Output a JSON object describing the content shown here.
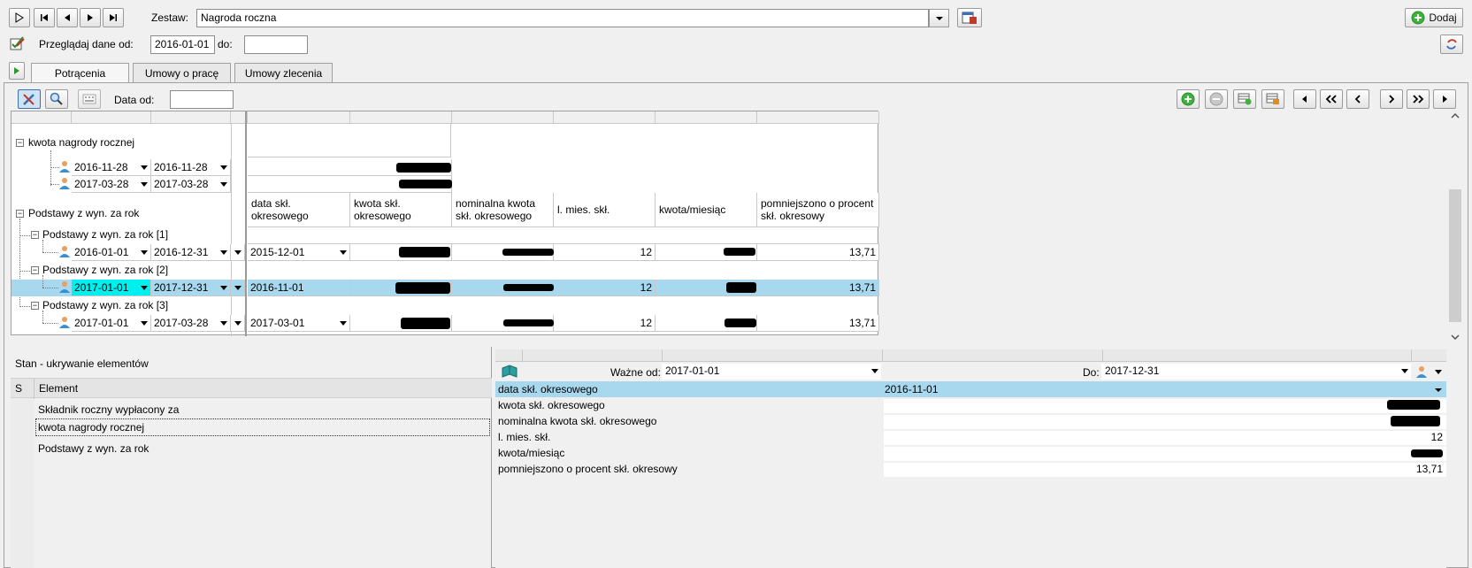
{
  "toolbar": {
    "zestaw_label": "Zestaw:",
    "zestaw_value": "Nagroda roczna",
    "dodaj_label": "Dodaj",
    "przegladaj_label": "Przeglądaj dane od:",
    "od_value": "2016-01-01",
    "do_label": "do:",
    "do_value": ""
  },
  "tabs": [
    "Potrącenia",
    "Umowy o pracę",
    "Umowy zlecenia"
  ],
  "grid_toolbar": {
    "data_od_label": "Data od:",
    "data_od_value": ""
  },
  "grid": {
    "group1_label": "kwota nagrody rocznej",
    "group1_rows": [
      {
        "from": "2016-11-28",
        "to": "2016-11-28"
      },
      {
        "from": "2017-03-28",
        "to": "2017-03-28"
      }
    ],
    "group2_label": "Podstawy z wyn. za rok",
    "columns": [
      "data skł. okresowego",
      "kwota skł. okresowego",
      "nominalna kwota skł. okresowego",
      "l. mies. skł.",
      "kwota/miesiąc",
      "pomniejszono o procent skł. okresowy"
    ],
    "subgroups": [
      {
        "label": "Podstawy z wyn. za rok [1]",
        "from": "2016-01-01",
        "to": "2016-12-31",
        "data": "2015-12-01",
        "mies": "12",
        "procent": "13,71"
      },
      {
        "label": "Podstawy z wyn. za rok [2]",
        "from": "2017-01-01",
        "to": "2017-12-31",
        "data": "2016-11-01",
        "mies": "12",
        "procent": "13,71"
      },
      {
        "label": "Podstawy z wyn. za rok [3]",
        "from": "2017-01-01",
        "to": "2017-03-28",
        "data": "2017-03-01",
        "mies": "12",
        "procent": "13,71"
      }
    ]
  },
  "left_panel": {
    "title": "Stan - ukrywanie elementów",
    "col_s": "S",
    "col_element": "Element",
    "items": [
      "Składnik roczny wypłacony za",
      "kwota nagrody rocznej",
      "Podstawy z wyn. za rok"
    ]
  },
  "right_panel": {
    "wazne_od_label": "Ważne od:",
    "wazne_od_value": "2017-01-01",
    "do_label": "Do:",
    "do_value": "2017-12-31",
    "rows": [
      {
        "label": "data skł. okresowego",
        "value": "2016-11-01"
      },
      {
        "label": "kwota skł. okresowego",
        "value": ""
      },
      {
        "label": "nominalna kwota skł. okresowego",
        "value": ""
      },
      {
        "label": "l. mies. skł.",
        "value": "12"
      },
      {
        "label": "kwota/miesiąc",
        "value": ""
      },
      {
        "label": "pomniejszono o procent skł. okresowy",
        "value": "13,71"
      }
    ]
  },
  "colors": {
    "selected_row": "#a8d8ee",
    "cyan": "#00f0f0"
  }
}
